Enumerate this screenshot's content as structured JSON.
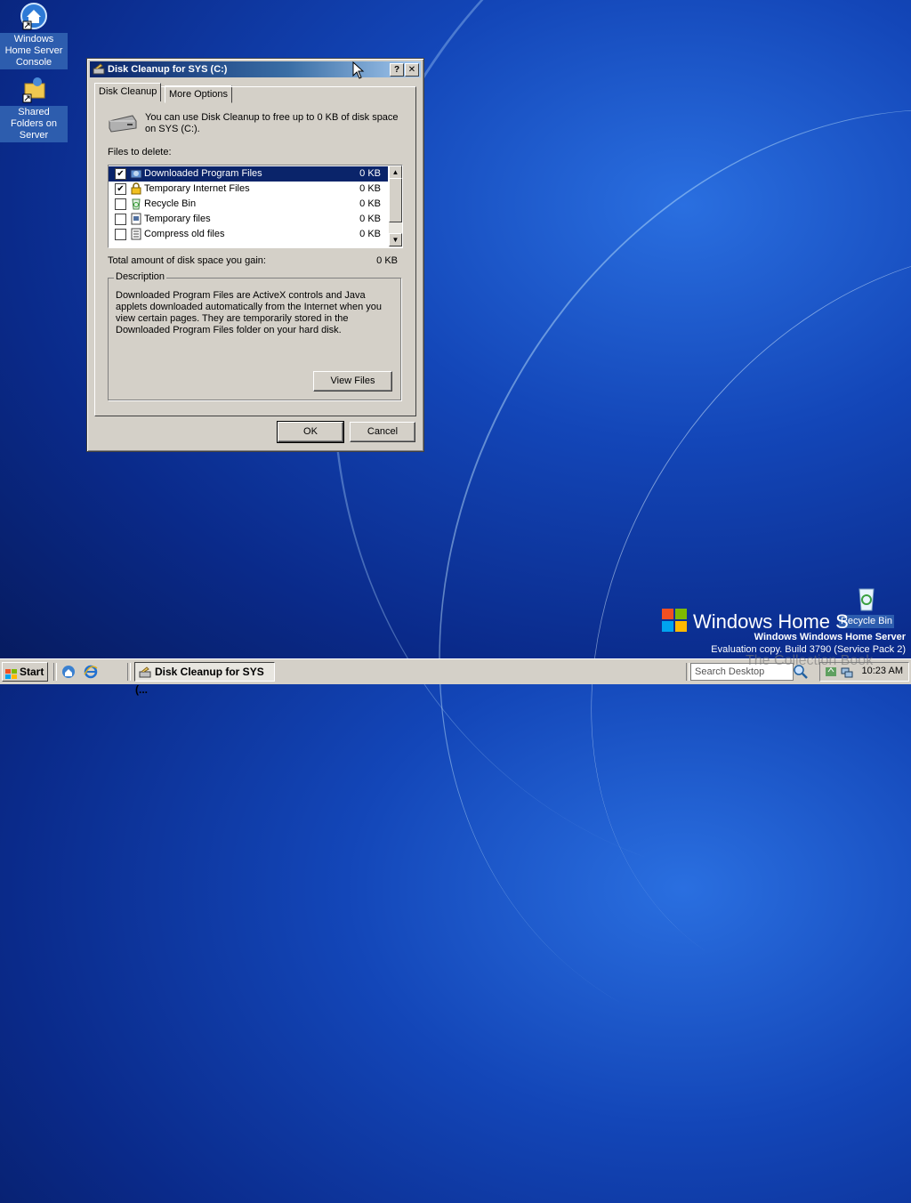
{
  "desktop": {
    "icons": [
      {
        "label": "Windows Home Server Console"
      },
      {
        "label": "Shared Folders on Server"
      },
      {
        "label": "Recycle Bin"
      }
    ],
    "brand_text": "Windows Home S",
    "watermark_line1": "Windows Windows Home Server",
    "watermark_line2": "Evaluation copy. Build 3790 (Service Pack 2)",
    "overlay_text": "The Collection Book"
  },
  "dialog": {
    "title": "Disk Cleanup for SYS (C:)",
    "help_btn": "?",
    "close_btn": "✕",
    "tabs": [
      {
        "label": "Disk Cleanup"
      },
      {
        "label": "More Options"
      }
    ],
    "intro": "You can use Disk Cleanup to free up to 0 KB of disk space on SYS (C:).",
    "files_label": "Files to delete:",
    "files": [
      {
        "name": "Downloaded Program Files",
        "size": "0 KB",
        "checked": "✔"
      },
      {
        "name": "Temporary Internet Files",
        "size": "0 KB",
        "checked": "✔"
      },
      {
        "name": "Recycle Bin",
        "size": "0 KB",
        "checked": ""
      },
      {
        "name": "Temporary files",
        "size": "0 KB",
        "checked": ""
      },
      {
        "name": "Compress old files",
        "size": "0 KB",
        "checked": ""
      }
    ],
    "total_label": "Total amount of disk space you gain:",
    "total_value": "0 KB",
    "description_title": "Description",
    "description_text": "Downloaded Program Files are ActiveX controls and Java applets downloaded automatically from the Internet when you view certain pages. They are temporarily stored in the Downloaded Program Files folder on your hard disk.",
    "view_files": "View Files",
    "ok": "OK",
    "cancel": "Cancel"
  },
  "taskbar": {
    "start": "Start",
    "task": "Disk Cleanup for SYS (...",
    "search_placeholder": "Search Desktop",
    "clock": "10:23 AM"
  }
}
